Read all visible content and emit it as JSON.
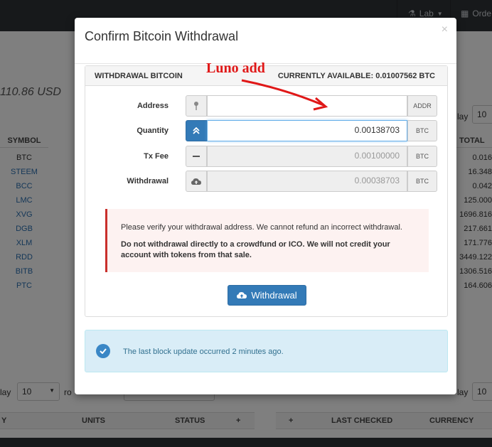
{
  "topbar": {
    "lab_label": "Lab",
    "orders_label": "Orde"
  },
  "background": {
    "balance": "110.86 USD",
    "columns": {
      "symbol": "SYMBOL",
      "total": "TOTAL"
    },
    "symbols": [
      "BTC",
      "STEEM",
      "BCC",
      "LMC",
      "XVG",
      "DGB",
      "XLM",
      "RDD",
      "BITB",
      "PTC"
    ],
    "totals": [
      "0.016",
      "16.348",
      "0.042",
      "125.000",
      "1696.816",
      "217.661",
      "171.776",
      "3449.122",
      "1306.516",
      "164.606"
    ],
    "display_label": "lay",
    "display_value": "10",
    "display_label_2": "lay",
    "display_value_2": "10",
    "display_value_3": "10",
    "rows_label": "ro",
    "bottom_left_headers": [
      "Y",
      "UNITS",
      "STATUS",
      "+"
    ],
    "bottom_right_headers": [
      "+",
      "LAST CHECKED",
      "CURRENCY"
    ]
  },
  "modal": {
    "title": "Confirm Bitcoin Withdrawal",
    "close": "×",
    "panel": {
      "heading": "WITHDRAWAL BITCOIN",
      "available": "CURRENTLY AVAILABLE: 0.01007562 BTC"
    },
    "form": {
      "address": {
        "label": "Address",
        "value": "",
        "unit": "ADDR",
        "icon": "pin-icon"
      },
      "quantity": {
        "label": "Quantity",
        "value": "0.00138703",
        "unit": "BTC",
        "icon": "double-chevron-up-icon"
      },
      "txfee": {
        "label": "Tx Fee",
        "value": "0.00100000",
        "unit": "BTC",
        "icon": "minus-icon"
      },
      "withdrawal": {
        "label": "Withdrawal",
        "value": "0.00038703",
        "unit": "BTC",
        "icon": "cloud-upload-icon"
      }
    },
    "warning": {
      "line1": "Please verify your withdrawal address. We cannot refund an incorrect withdrawal.",
      "line2": "Do not withdrawal directly to a crowdfund or ICO. We will not credit your account with tokens from that sale."
    },
    "button_label": "Withdrawal",
    "info": "The last block update occurred 2 minutes ago."
  },
  "annotation": {
    "text": "Luno add"
  },
  "colors": {
    "primary": "#337ab7",
    "danger": "#c9302c",
    "annotation": "#e01818",
    "info_bg": "#d9edf7"
  }
}
